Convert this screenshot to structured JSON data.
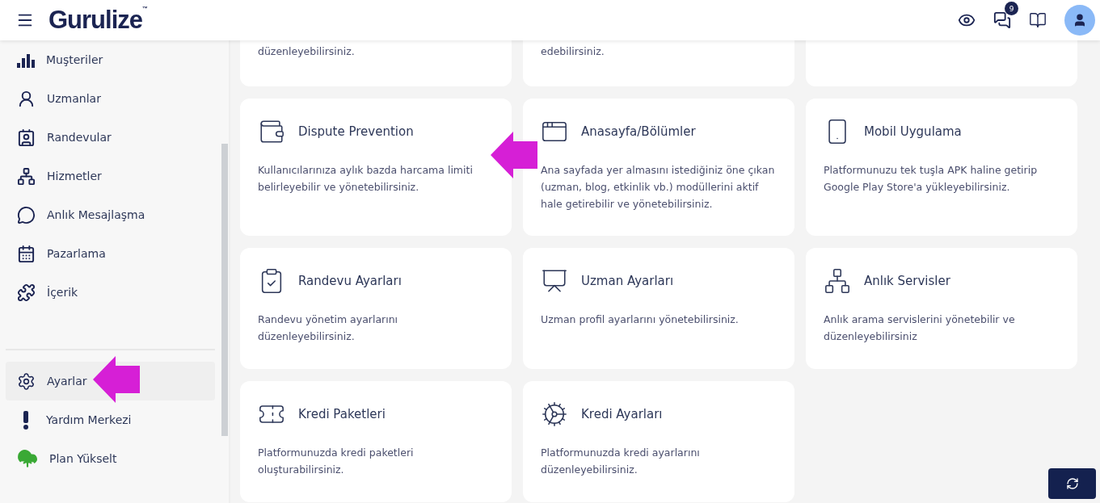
{
  "header": {
    "logo": "Gurulize",
    "logo_mark": "™",
    "chat_badge": "9"
  },
  "sidebar": {
    "items": [
      {
        "label": "Muşteriler",
        "selected": false,
        "pointer": false
      },
      {
        "label": "Uzmanlar",
        "selected": false,
        "pointer": false
      },
      {
        "label": "Randevular",
        "selected": false,
        "pointer": false
      },
      {
        "label": "Hizmetler",
        "selected": false,
        "pointer": false
      },
      {
        "label": "Anlık Mesajlaşma",
        "selected": false,
        "pointer": false
      },
      {
        "label": "Pazarlama",
        "selected": false,
        "pointer": false
      },
      {
        "label": "İçerik",
        "selected": false,
        "pointer": false
      }
    ],
    "bottom_items": [
      {
        "label": "Ayarlar",
        "selected": true,
        "pointer": true
      },
      {
        "label": "Yardım Merkezi",
        "selected": false,
        "pointer": false
      },
      {
        "label": "Plan Yükselt",
        "selected": false,
        "pointer": false
      }
    ]
  },
  "cards": [
    {
      "kind": "partial",
      "description": "düzenleyebilirsiniz."
    },
    {
      "kind": "partial",
      "description": "edebilirsiniz."
    },
    {
      "kind": "partial"
    },
    {
      "kind": "full",
      "title": "Dispute Prevention",
      "description": "Kullanıcılarınıza aylık bazda harcama limiti belirleyebilir ve yönetebilirsiniz.",
      "pointer": true
    },
    {
      "kind": "full",
      "title": "Anasayfa/Bölümler",
      "description": "Ana sayfada yer almasını istediğiniz öne çıkan (uzman, blog, etkinlik vb.) modüllerini aktif hale getirebilir ve yönetebilirsiniz.",
      "pointer": false
    },
    {
      "kind": "full",
      "title": "Mobil Uygulama",
      "description": "Platformunuzu tek tuşla APK haline getirip Google Play Store'a yükleyebilirsiniz.",
      "pointer": false
    },
    {
      "kind": "full",
      "title": "Randevu Ayarları",
      "description": "Randevu yönetim ayarlarını düzenleyebilirsiniz.",
      "pointer": false
    },
    {
      "kind": "full",
      "title": "Uzman Ayarları",
      "description": "Uzman profil ayarlarını yönetebilirsiniz.",
      "pointer": false
    },
    {
      "kind": "full",
      "title": "Anlık Servisler",
      "description": "Anlık arama servislerini yönetebilir ve düzenleyebilirsiniz",
      "pointer": false
    },
    {
      "kind": "full",
      "title": "Kredi Paketleri",
      "description": "Platformunuzda kredi paketleri oluşturabilirsiniz.",
      "pointer": false
    },
    {
      "kind": "full",
      "title": "Kredi Ayarları",
      "description": "Platformunuzda kredi ayarlarını düzenleyebilirsiniz.",
      "pointer": false
    }
  ]
}
